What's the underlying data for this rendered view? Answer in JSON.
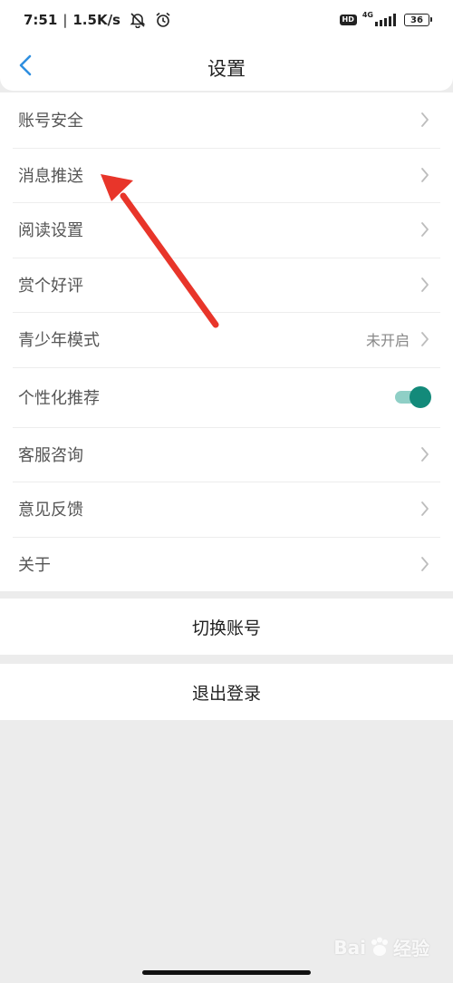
{
  "status_bar": {
    "time": "7:51",
    "separator": "|",
    "net_speed": "1.5K/s",
    "hd_label": "HD",
    "network_type": "4G",
    "battery_level": "36",
    "icons": [
      "bell-off-icon",
      "alarm-clock-icon",
      "signal-icon",
      "battery-icon"
    ]
  },
  "header": {
    "title": "设置",
    "back_icon": "chevron-left-icon",
    "accent_color": "#2f8fe0"
  },
  "settings": {
    "items": [
      {
        "label": "账号安全"
      },
      {
        "label": "消息推送"
      },
      {
        "label": "阅读设置"
      },
      {
        "label": "赏个好评"
      },
      {
        "label": "青少年模式",
        "value": "未开启"
      },
      {
        "label": "个性化推荐",
        "toggle": true
      },
      {
        "label": "客服咨询"
      },
      {
        "label": "意见反馈"
      },
      {
        "label": "关于"
      }
    ],
    "toggle_on_color": "#138a7a"
  },
  "actions": {
    "switch_account": "切换账号",
    "logout": "退出登录"
  },
  "watermark": {
    "text": "Bai",
    "text2": "经验"
  },
  "annotation": {
    "arrow_color": "#e8352a"
  }
}
